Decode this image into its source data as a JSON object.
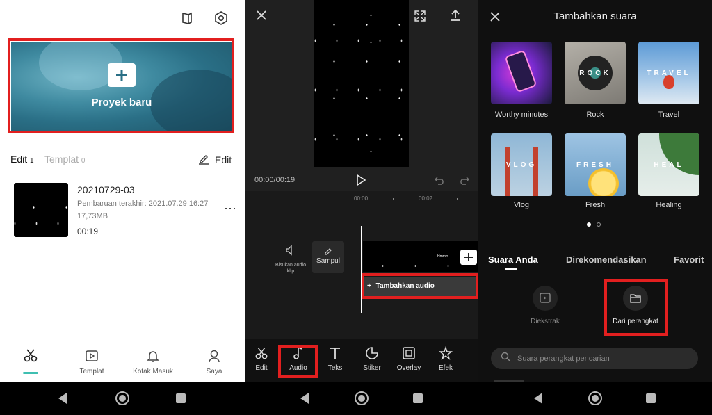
{
  "panel1": {
    "new_project_label": "Proyek baru",
    "tabs": [
      {
        "label": "Edit",
        "count": "1"
      },
      {
        "label": "Templat",
        "count": "0"
      }
    ],
    "edit_label": "Edit",
    "project": {
      "title": "20210729-03",
      "updated": "Pembaruan terakhir: 2021.07.29 16:27",
      "size": "17,73MB",
      "duration": "00:19"
    },
    "bottom_nav": [
      {
        "label": ""
      },
      {
        "label": "Templat"
      },
      {
        "label": "Kotak Masuk"
      },
      {
        "label": "Saya"
      }
    ]
  },
  "panel2": {
    "time": "00:00/00:19",
    "ruler": [
      "00:00",
      "00:02"
    ],
    "mute_label": "Bisukan audio klip",
    "cover_label": "Sampul",
    "clip_text": "Hmmm",
    "add_audio_label": "Tambahkan audio",
    "tools": [
      {
        "label": "Edit",
        "icon": "scissors-icon"
      },
      {
        "label": "Audio",
        "icon": "music-note-icon"
      },
      {
        "label": "Teks",
        "icon": "text-icon"
      },
      {
        "label": "Stiker",
        "icon": "sticker-icon"
      },
      {
        "label": "Overlay",
        "icon": "overlay-icon"
      },
      {
        "label": "Efek",
        "icon": "effects-icon"
      }
    ]
  },
  "panel3": {
    "title": "Tambahkan suara",
    "cards": [
      {
        "label": "Worthy minutes",
        "word": ""
      },
      {
        "label": "Rock",
        "word": "ROCK"
      },
      {
        "label": "Travel",
        "word": "TRAVEL"
      },
      {
        "label": "Vlog",
        "word": "VLOG"
      },
      {
        "label": "Fresh",
        "word": "FRESH"
      },
      {
        "label": "Healing",
        "word": "HEAL"
      }
    ],
    "tabs": [
      "Suara Anda",
      "Direkomendasikan",
      "Favorit"
    ],
    "extracted_label": "Diekstrak",
    "from_device_label": "Dari perangkat",
    "search_placeholder": "Suara perangkat pencarian"
  },
  "colors": {
    "accent_red": "#e21f1f",
    "teal_indicator": "#3fbfb1"
  }
}
